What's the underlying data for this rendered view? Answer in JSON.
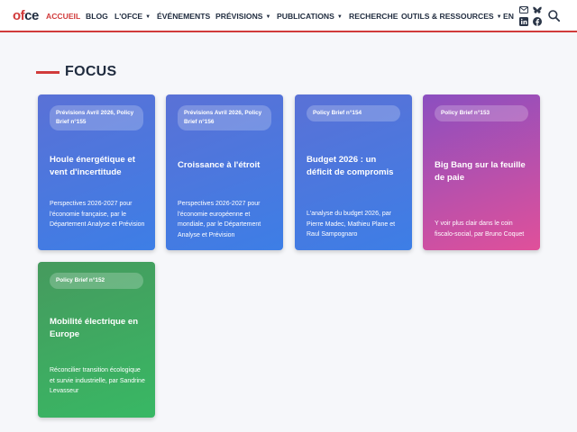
{
  "brand": {
    "logo_prefix": "o",
    "logo_f": "f",
    "logo_suffix": "ce"
  },
  "nav": {
    "home": "ACCUEIL",
    "blog": "BLOG",
    "about": "L'OFCE",
    "events": "ÉVÉNEMENTS",
    "forecasts": "PRÉVISIONS",
    "publications": "PUBLICATIONS",
    "research": "RECHERCHE",
    "tools": "OUTILS & RESSOURCES",
    "lang": "EN"
  },
  "icons": {
    "mail": "mail-icon",
    "bluesky": "bluesky-icon",
    "linkedin": "linkedin-icon",
    "facebook": "facebook-icon",
    "search": "search-icon",
    "dropdown": "chevron-down-icon"
  },
  "colors": {
    "accent": "#d13b3b",
    "blue_gradient": [
      "#5a71d6",
      "#3d7ee6"
    ],
    "purple_gradient": [
      "#8b4fc0",
      "#e0509a"
    ],
    "green_gradient": [
      "#469a5e",
      "#38b864"
    ]
  },
  "section": {
    "title": "FOCUS"
  },
  "cards": [
    {
      "tag": "Prévisions Avril 2026, Policy Brief n°155",
      "title": "Houle énergétique et vent d'incertitude",
      "description": "Perspectives 2026-2027 pour l'économie française, par le Département Analyse et Prévision"
    },
    {
      "tag": "Prévisions Avril 2026, Policy Brief n°156",
      "title": "Croissance à l'étroit",
      "description": "Perspectives 2026-2027 pour l'économie européenne et mondiale, par le Département Analyse et Prévision"
    },
    {
      "tag": "Policy Brief n°154",
      "title": "Budget 2026 : un déficit de compromis",
      "description": "L'analyse du budget 2026, par Pierre Madec, Mathieu Plane et Raul Sampognaro"
    },
    {
      "tag": "Policy Brief n°153",
      "title": "Big Bang sur la feuille de paie",
      "description": "Y voir plus clair dans le coin fiscalo-social, par Bruno Coquet"
    },
    {
      "tag": "Policy Brief n°152",
      "title": "Mobilité électrique en Europe",
      "description": "Réconcilier transition écologique et survie industrielle, par Sandrine Levasseur"
    }
  ]
}
